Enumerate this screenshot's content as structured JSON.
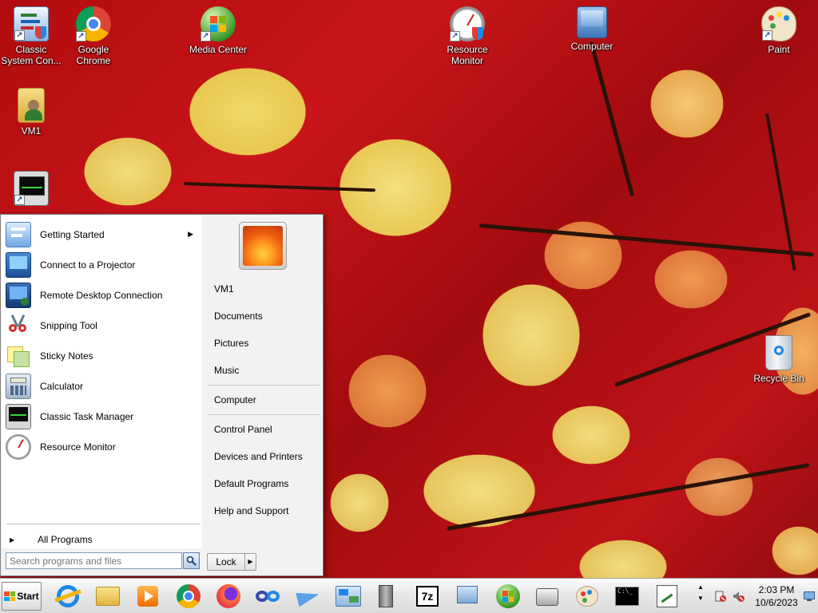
{
  "desktop": {
    "icons": [
      {
        "label": "Classic System Con...",
        "icon": "control-panel-icon"
      },
      {
        "label": "Google Chrome",
        "icon": "chrome-icon"
      },
      {
        "label": "Media Center",
        "icon": "media-center-icon"
      },
      {
        "label": "Resource Monitor",
        "icon": "resource-monitor-icon"
      },
      {
        "label": "Computer",
        "icon": "computer-icon"
      },
      {
        "label": "Paint",
        "icon": "paint-icon"
      },
      {
        "label": "VM1",
        "icon": "user-folder-icon"
      },
      {
        "label": "Recycle Bin",
        "icon": "recycle-bin-icon"
      }
    ]
  },
  "start_menu": {
    "programs": [
      {
        "label": "Getting Started",
        "icon": "getting-started-icon",
        "has_submenu": true
      },
      {
        "label": "Connect to a Projector",
        "icon": "projector-icon"
      },
      {
        "label": "Remote Desktop Connection",
        "icon": "remote-desktop-icon"
      },
      {
        "label": "Snipping Tool",
        "icon": "scissors-icon"
      },
      {
        "label": "Sticky Notes",
        "icon": "sticky-notes-icon"
      },
      {
        "label": "Calculator",
        "icon": "calculator-icon"
      },
      {
        "label": "Classic Task Manager",
        "icon": "task-manager-icon"
      },
      {
        "label": "Resource Monitor",
        "icon": "resource-monitor-icon"
      }
    ],
    "all_programs": "All Programs",
    "search_placeholder": "Search programs and files",
    "places": [
      "VM1",
      "Documents",
      "Pictures",
      "Music",
      "Computer",
      "Control Panel",
      "Devices and Printers",
      "Default Programs",
      "Help and Support"
    ],
    "lock_label": "Lock"
  },
  "taskbar": {
    "start_label": "Start",
    "pinned": [
      "internet-explorer-icon",
      "file-explorer-icon",
      "media-player-icon",
      "chrome-icon",
      "firefox-icon",
      "infinity-app-icon",
      "paper-plane-icon",
      "network-icon",
      "server-icon",
      "seven-zip-icon",
      "magnifier-icon",
      "windows-orb-icon",
      "fax-icon",
      "paint-icon",
      "command-prompt-icon",
      "chart-editor-icon"
    ],
    "clock_time": "2:03 PM",
    "clock_date": "10/6/2023",
    "colors": {
      "accent": "#1c5fb8",
      "taskbar": "#e6e6e6"
    }
  }
}
